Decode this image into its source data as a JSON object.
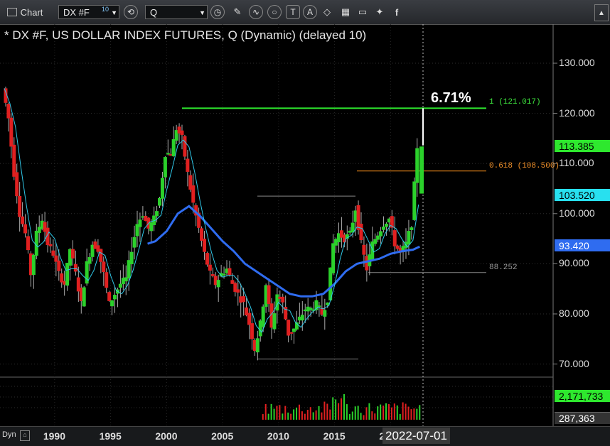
{
  "toolbar": {
    "app_label": "Chart",
    "symbol_value": "DX #F",
    "symbol_superscript": "10",
    "period_value": "Q",
    "icons": [
      "clock-icon",
      "pencil-icon",
      "wave-icon",
      "circle-icon",
      "text-icon",
      "alert-icon",
      "eraser-icon",
      "grid-icon",
      "comment-icon",
      "twitter-icon",
      "facebook-icon"
    ]
  },
  "chart_title": "* DX #F, US DOLLAR INDEX FUTURES, Q (Dynamic) (delayed 10)",
  "annotations": {
    "pct_change": "6.71%",
    "fib_1_label": "1 (121.017)",
    "fib_0618_label": "0.618 (108.500)",
    "low_label": "88.252",
    "price_tag": "113.385",
    "ma_fast_tag": "103.520",
    "ma_slow_tag": "93.420",
    "volume_tag": "2,171,733",
    "volume_tag2": "287,363",
    "date_tag": "2022-07-01",
    "dyn_label": "Dyn"
  },
  "colors": {
    "up": "#2bd12b",
    "down": "#e02020",
    "ma_slow": "#2f6cf0",
    "ma_fast": "#30c8e8",
    "fib_1": "#2ee82e",
    "fib_0618": "#f08a1a",
    "tag_price": "#2ee82e",
    "tag_fast": "#28e0ef",
    "tag_slow": "#2f6cf0"
  },
  "chart_data": {
    "type": "candlestick",
    "title": "* DX #F, US DOLLAR INDEX FUTURES, Q (Dynamic) (delayed 10)",
    "ylim": [
      67,
      134
    ],
    "yticks": [
      "130.000",
      "120.000",
      "110.000",
      "100.000",
      "90.000",
      "80.000",
      "70.000"
    ],
    "ytick_values": [
      130,
      120,
      110,
      100,
      90,
      80,
      70
    ],
    "xticks": [
      "1990",
      "1995",
      "2000",
      "2005",
      "2010",
      "2015",
      "2020"
    ],
    "xtick_years": [
      1990,
      1995,
      2000,
      2005,
      2010,
      2015,
      2020
    ],
    "xlim": [
      1985.5,
      2022.9
    ],
    "close_series": [
      [
        1985.5,
        125
      ],
      [
        1986,
        119
      ],
      [
        1986.5,
        108
      ],
      [
        1987,
        100
      ],
      [
        1987.5,
        96
      ],
      [
        1988,
        88
      ],
      [
        1988.5,
        96
      ],
      [
        1989,
        99
      ],
      [
        1989.5,
        94
      ],
      [
        1990,
        92
      ],
      [
        1990.5,
        88
      ],
      [
        1991,
        86
      ],
      [
        1991.5,
        93
      ],
      [
        1992,
        88
      ],
      [
        1992.5,
        82
      ],
      [
        1993,
        90
      ],
      [
        1993.5,
        94
      ],
      [
        1994,
        93
      ],
      [
        1994.5,
        88
      ],
      [
        1995,
        82
      ],
      [
        1995.5,
        84
      ],
      [
        1996,
        86
      ],
      [
        1996.5,
        87
      ],
      [
        1997,
        93
      ],
      [
        1997.5,
        98
      ],
      [
        1998,
        100
      ],
      [
        1998.5,
        97
      ],
      [
        1999,
        99
      ],
      [
        1999.5,
        103
      ],
      [
        2000,
        112
      ],
      [
        2000.5,
        112
      ],
      [
        2001,
        117
      ],
      [
        2001.5,
        115
      ],
      [
        2002,
        108
      ],
      [
        2002.5,
        102
      ],
      [
        2003,
        97
      ],
      [
        2003.5,
        92
      ],
      [
        2004,
        88
      ],
      [
        2004.5,
        86
      ],
      [
        2005,
        88
      ],
      [
        2005.5,
        89
      ],
      [
        2006,
        86
      ],
      [
        2006.5,
        84
      ],
      [
        2007,
        82
      ],
      [
        2007.5,
        78
      ],
      [
        2008,
        73
      ],
      [
        2008.5,
        78
      ],
      [
        2009,
        86
      ],
      [
        2009.5,
        77
      ],
      [
        2010,
        84
      ],
      [
        2010.5,
        82
      ],
      [
        2011,
        76
      ],
      [
        2011.5,
        77
      ],
      [
        2012,
        79
      ],
      [
        2012.5,
        81
      ],
      [
        2013,
        81
      ],
      [
        2013.5,
        82
      ],
      [
        2014,
        80
      ],
      [
        2014.5,
        83
      ],
      [
        2015,
        94
      ],
      [
        2015.5,
        96
      ],
      [
        2016,
        95
      ],
      [
        2016.5,
        96
      ],
      [
        2017,
        101
      ],
      [
        2017.5,
        94
      ],
      [
        2018,
        89
      ],
      [
        2018.5,
        94
      ],
      [
        2019,
        96
      ],
      [
        2019.5,
        98
      ],
      [
        2020,
        99
      ],
      [
        2020.5,
        94
      ],
      [
        2021,
        92
      ],
      [
        2021.5,
        94
      ],
      [
        2022,
        98
      ],
      [
        2022.5,
        113.385
      ]
    ],
    "ma_slow": [
      [
        1998.3,
        94
      ],
      [
        1999,
        94.5
      ],
      [
        2000,
        96.5
      ],
      [
        2001,
        100
      ],
      [
        2002,
        101.5
      ],
      [
        2003,
        99.5
      ],
      [
        2004,
        97
      ],
      [
        2005,
        94.5
      ],
      [
        2006,
        92.5
      ],
      [
        2007,
        90
      ],
      [
        2008,
        88.5
      ],
      [
        2009,
        87
      ],
      [
        2010,
        85.5
      ],
      [
        2011,
        84
      ],
      [
        2012,
        83.5
      ],
      [
        2013,
        83.5
      ],
      [
        2014,
        84
      ],
      [
        2015,
        86
      ],
      [
        2016,
        88.5
      ],
      [
        2017,
        90
      ],
      [
        2018,
        90.5
      ],
      [
        2019,
        91
      ],
      [
        2020,
        92
      ],
      [
        2021,
        92.5
      ],
      [
        2022,
        92.8
      ],
      [
        2022.6,
        93.42
      ]
    ],
    "ma_fast_last": 103.52,
    "fib_levels": [
      {
        "label": "1 (121.017)",
        "value": 121.017
      },
      {
        "label": "0.618 (108.500)",
        "value": 108.5
      }
    ],
    "ref_levels": [
      {
        "label": "88.252",
        "value": 88.252
      },
      {
        "label": "",
        "value": 103.5
      },
      {
        "label": "",
        "value": 71
      }
    ],
    "last_price": 113.385,
    "pct_change": "6.71%"
  }
}
